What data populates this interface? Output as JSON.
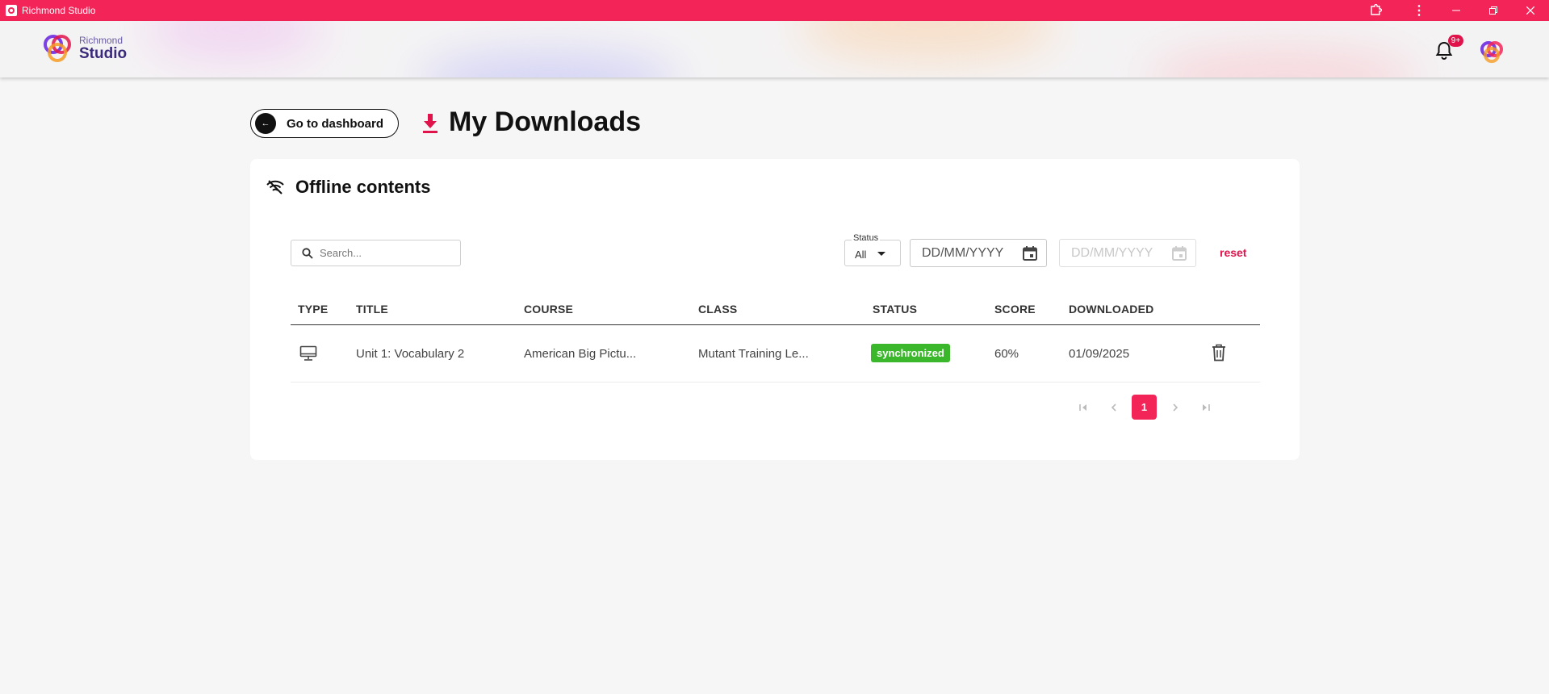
{
  "window": {
    "title": "Richmond Studio"
  },
  "header": {
    "logo_line1": "Richmond",
    "logo_line2": "Studio",
    "notification_badge": "9+"
  },
  "page": {
    "back_label": "Go to dashboard",
    "title": "My Downloads"
  },
  "card": {
    "title": "Offline contents",
    "search_placeholder": "Search...",
    "status_label": "Status",
    "status_value": "All",
    "date_from_placeholder": "DD/MM/YYYY",
    "date_to_placeholder": "DD/MM/YYYY",
    "reset_label": "reset"
  },
  "table": {
    "columns": [
      "TYPE",
      "TITLE",
      "COURSE",
      "CLASS",
      "STATUS",
      "SCORE",
      "DOWNLOADED"
    ],
    "rows": [
      {
        "type_icon": "monitor-icon",
        "title": "Unit 1: Vocabulary 2",
        "course": "American Big Pictu...",
        "class": "Mutant Training Le...",
        "status": "synchronized",
        "score": "60%",
        "downloaded": "01/09/2025"
      }
    ]
  },
  "pagination": {
    "current_page": "1"
  },
  "colors": {
    "brand": "#f32558",
    "sync_green": "#3ab72a",
    "accent_red": "#e0144a"
  }
}
